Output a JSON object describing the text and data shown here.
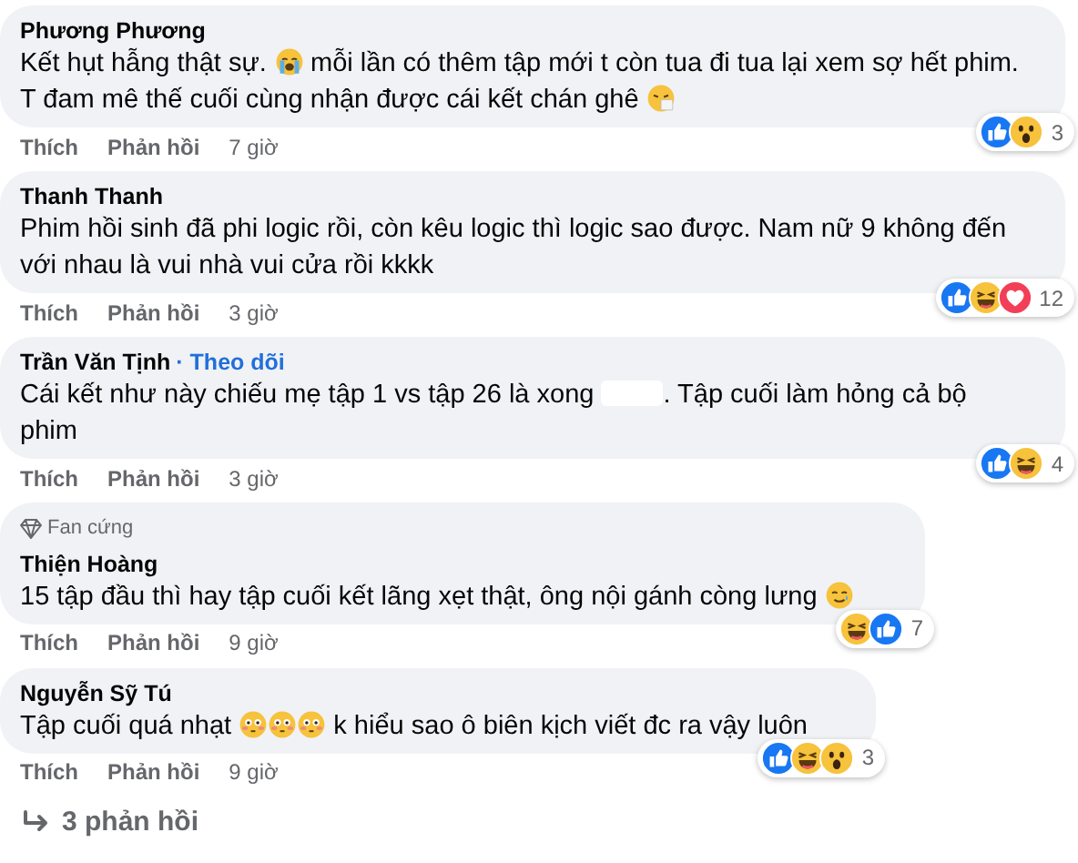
{
  "comments": [
    {
      "name": "Phương Phương",
      "segments": [
        {
          "kind": "text",
          "text": "Kết hụt hẫng thật sự. "
        },
        {
          "kind": "crying"
        },
        {
          "kind": "text",
          "text": " mỗi lần có thêm tập mới t còn tua đi tua lại xem sợ hết phim. T đam mê thế cuối cùng nhận được cái kết chán ghê "
        },
        {
          "kind": "sick"
        }
      ],
      "like": "Thích",
      "reply": "Phản hồi",
      "time": "7 giờ",
      "reactions": [
        {
          "kind": "like"
        },
        {
          "kind": "wow"
        }
      ],
      "reaction_count": "3"
    },
    {
      "name": "Thanh Thanh",
      "segments": [
        {
          "kind": "text",
          "text": "Phim hồi sinh đã phi logic rồi, còn kêu logic thì logic sao được. Nam nữ 9 không đến với nhau là vui nhà vui cửa rồi kkkk"
        }
      ],
      "like": "Thích",
      "reply": "Phản hồi",
      "time": "3 giờ",
      "reactions": [
        {
          "kind": "like"
        },
        {
          "kind": "haha"
        },
        {
          "kind": "love"
        }
      ],
      "reaction_count": "12"
    },
    {
      "name": "Trần Văn Tịnh",
      "follow": "· Theo dõi",
      "segments": [
        {
          "kind": "text",
          "text": "Cái kết như này chiếu mẹ tập 1 vs tập 26 là xong "
        },
        {
          "kind": "redacted"
        },
        {
          "kind": "text",
          "text": ". Tập cuối làm hỏng cả bộ phim"
        }
      ],
      "like": "Thích",
      "reply": "Phản hồi",
      "time": "3 giờ",
      "reactions": [
        {
          "kind": "like"
        },
        {
          "kind": "haha"
        }
      ],
      "reaction_count": "4"
    },
    {
      "badge": "Fan cứng",
      "name": "Thiện Hoàng",
      "segments": [
        {
          "kind": "text",
          "text": "15 tập đầu thì hay tập cuối kết lãng xẹt thật, ông nội gánh còng lưng "
        },
        {
          "kind": "tear_smile"
        }
      ],
      "like": "Thích",
      "reply": "Phản hồi",
      "time": "9 giờ",
      "reactions": [
        {
          "kind": "haha"
        },
        {
          "kind": "like"
        }
      ],
      "reaction_count": "7"
    },
    {
      "name": "Nguyễn Sỹ Tú",
      "segments": [
        {
          "kind": "text",
          "text": "Tập cuối quá nhạt "
        },
        {
          "kind": "flushed"
        },
        {
          "kind": "flushed"
        },
        {
          "kind": "flushed"
        },
        {
          "kind": "text",
          "text": " k hiểu sao ô biên kịch viết đc ra vậy luôn"
        }
      ],
      "like": "Thích",
      "reply": "Phản hồi",
      "time": "9 giờ",
      "reactions": [
        {
          "kind": "like"
        },
        {
          "kind": "haha"
        },
        {
          "kind": "wow"
        }
      ],
      "reaction_count": "3"
    }
  ],
  "replies_link": "3 phản hồi"
}
